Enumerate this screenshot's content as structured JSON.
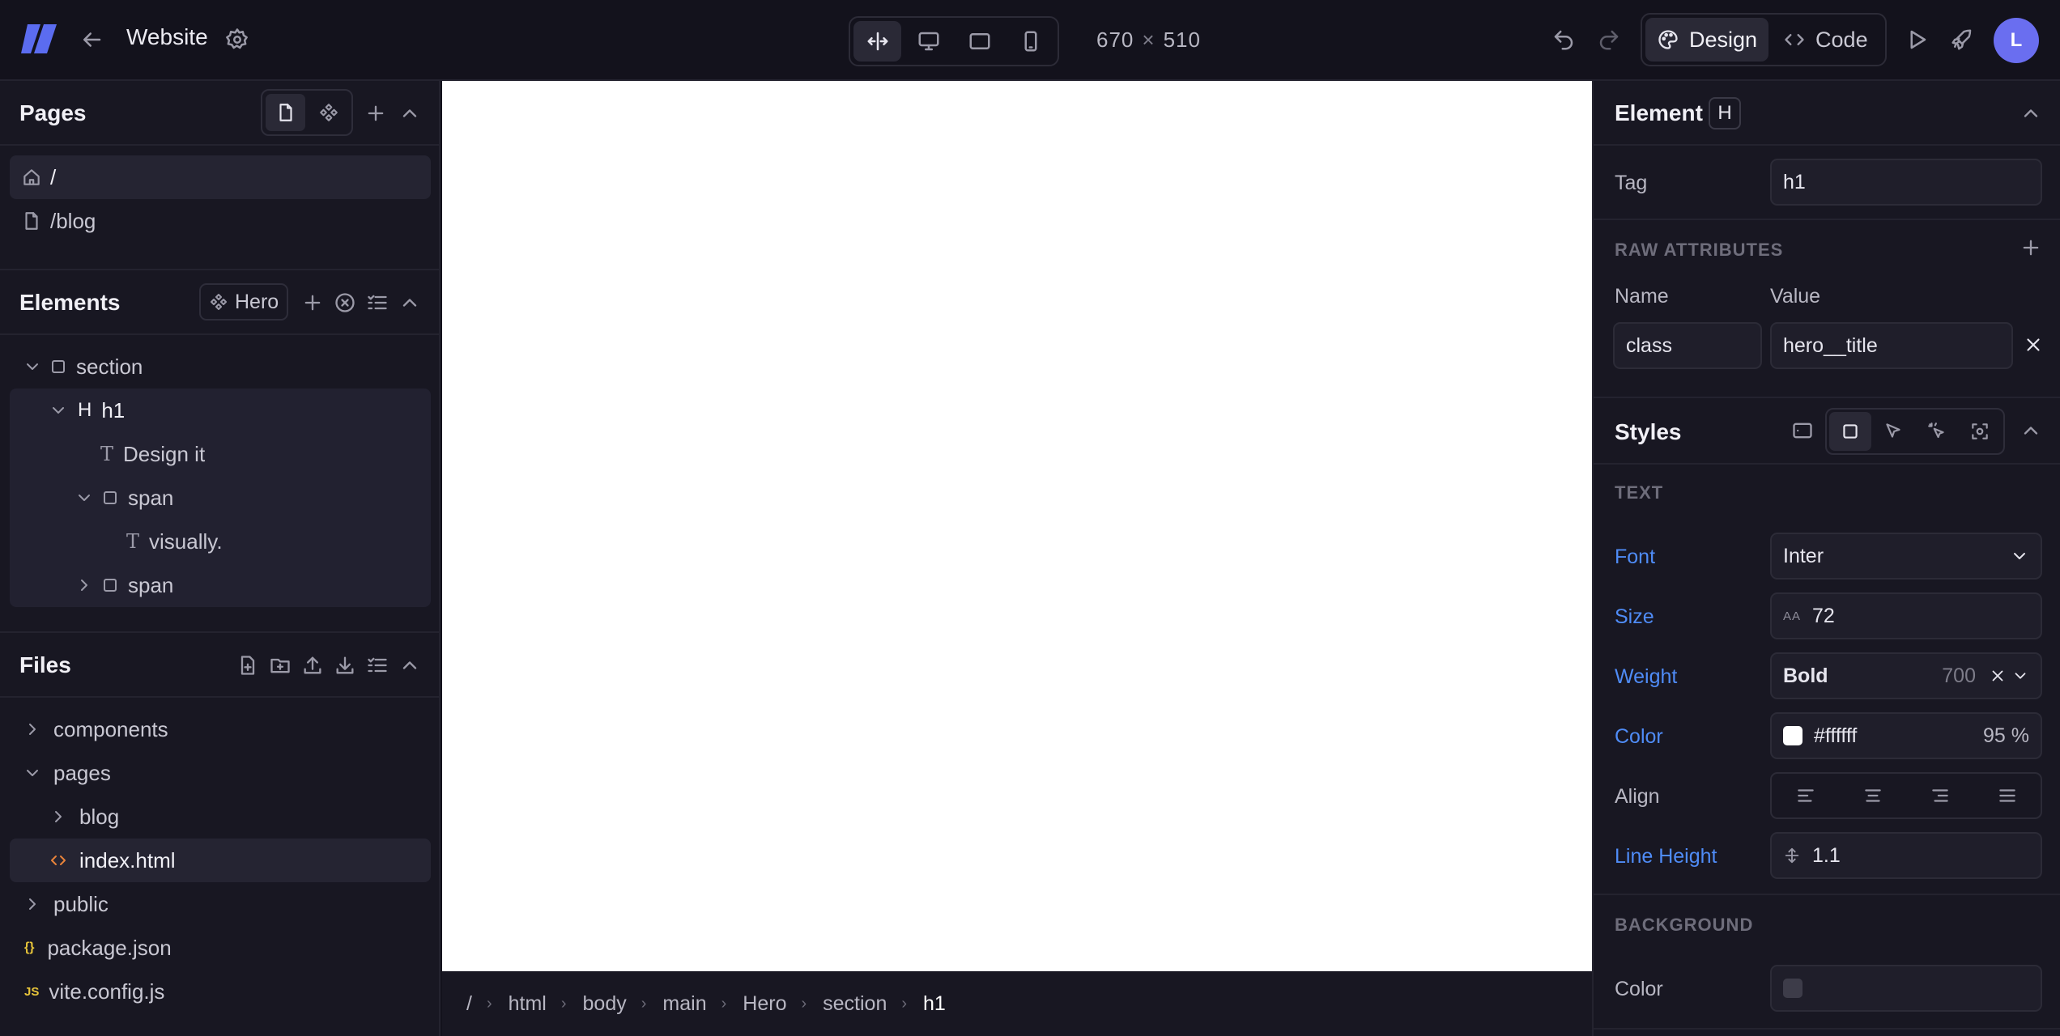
{
  "topbar": {
    "project_title": "Website",
    "canvas_width": "670",
    "canvas_height": "510",
    "dims_sep": "×",
    "modes": [
      {
        "label": "Design",
        "active": true
      },
      {
        "label": "Code",
        "active": false
      }
    ],
    "avatar_initial": "L"
  },
  "pages": {
    "title": "Pages",
    "items": [
      {
        "path": "/",
        "icon": "home-icon",
        "selected": true
      },
      {
        "path": "/blog",
        "icon": "file-icon",
        "selected": false
      }
    ]
  },
  "elements": {
    "title": "Elements",
    "component": "Hero",
    "tree": [
      {
        "label": "section",
        "icon": "box-icon",
        "expanded": true
      },
      {
        "label": "h1",
        "icon": "heading-icon",
        "glyph": "H",
        "expanded": true
      },
      {
        "label": "Design it",
        "icon": "text-icon",
        "glyph": "T"
      },
      {
        "label": "span",
        "icon": "box-icon",
        "expanded": true
      },
      {
        "label": "visually.",
        "icon": "text-icon",
        "glyph": "T"
      },
      {
        "label": "span",
        "icon": "box-icon",
        "expanded": false
      }
    ]
  },
  "files": {
    "title": "Files",
    "items": [
      {
        "label": "components",
        "type": "folder",
        "expanded": false
      },
      {
        "label": "pages",
        "type": "folder",
        "expanded": true
      },
      {
        "label": "blog",
        "type": "folder",
        "expanded": false
      },
      {
        "label": "index.html",
        "type": "html",
        "selected": true
      },
      {
        "label": "public",
        "type": "folder",
        "expanded": false
      },
      {
        "label": "package.json",
        "type": "json",
        "glyph": "{}"
      },
      {
        "label": "vite.config.js",
        "type": "js",
        "glyph": "JS"
      }
    ]
  },
  "breadcrumb": [
    "/",
    "html",
    "body",
    "main",
    "Hero",
    "section",
    "h1"
  ],
  "element_panel": {
    "title": "Element",
    "badge": "H",
    "tag_label": "Tag",
    "tag_value": "h1",
    "raw_attributes_title": "RAW ATTRIBUTES",
    "name_label": "Name",
    "value_label": "Value",
    "attr_name": "class",
    "attr_value": "hero__title"
  },
  "styles": {
    "title": "Styles",
    "text_section": "TEXT",
    "font_label": "Font",
    "font_value": "Inter",
    "size_label": "Size",
    "size_unit_icon": "AA",
    "size_value": "72",
    "weight_label": "Weight",
    "weight_value": "Bold",
    "weight_number": "700",
    "color_label": "Color",
    "color_value": "#ffffff",
    "color_opacity": "95 %",
    "align_label": "Align",
    "line_height_label": "Line Height",
    "line_height_value": "1.1",
    "background_section": "BACKGROUND",
    "bg_color_label": "Color"
  },
  "colors": {
    "accent": "#4f8cf7",
    "logo": "#5b6cf0",
    "avatar": "#6a6ef0",
    "html_icon": "#e8833a",
    "json_icon": "#e8c53a"
  }
}
